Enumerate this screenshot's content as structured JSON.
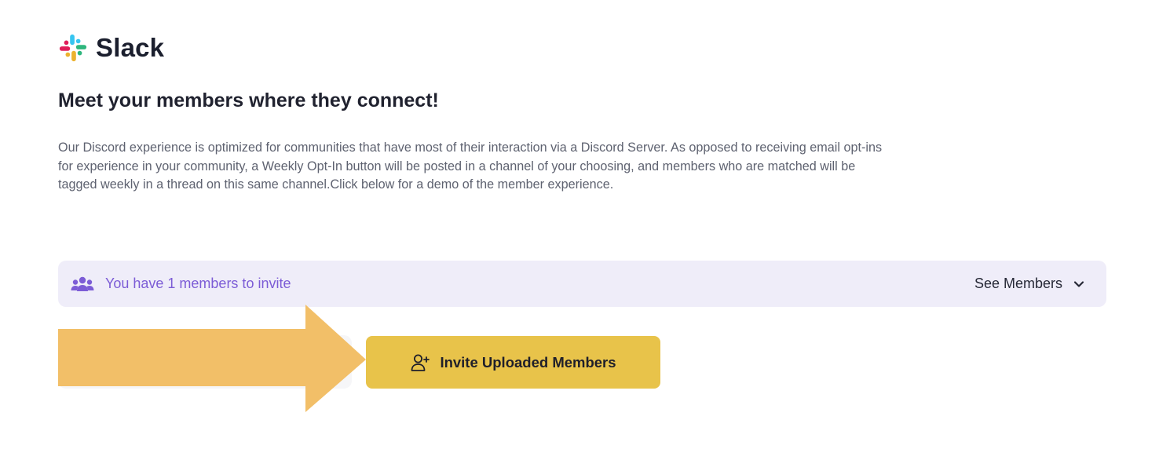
{
  "brand": {
    "name": "Slack",
    "logo_icon": "slack-logo-icon"
  },
  "headline": "Meet your members where they connect!",
  "description": "Our Discord experience is optimized for communities that have most of their interaction via a Discord Server. As opposed to receiving email opt-ins for experience in your community, a Weekly Opt-In button will be posted in a channel of your choosing, and members who are matched will be tagged weekly in a thread on this same channel.Click below for a demo of the member experience.",
  "invite_bar": {
    "icon": "users-group-icon",
    "message": "You have 1 members to invite",
    "see_members_label": "See Members",
    "toggle_icon": "chevron-down-icon"
  },
  "actions": {
    "invite_button_label": "Invite Uploaded Members",
    "invite_button_icon": "user-plus-icon"
  },
  "annotation": {
    "arrow_icon": "arrow-right-annotation"
  },
  "colors": {
    "page_background": "#ffffff",
    "heading_text": "#20222f",
    "body_text": "#5e6270",
    "invite_bar_background": "#efedf9",
    "accent_purple": "#7c5cd6",
    "primary_button": "#e8c34a",
    "annotation_arrow": "#f2bf68"
  }
}
